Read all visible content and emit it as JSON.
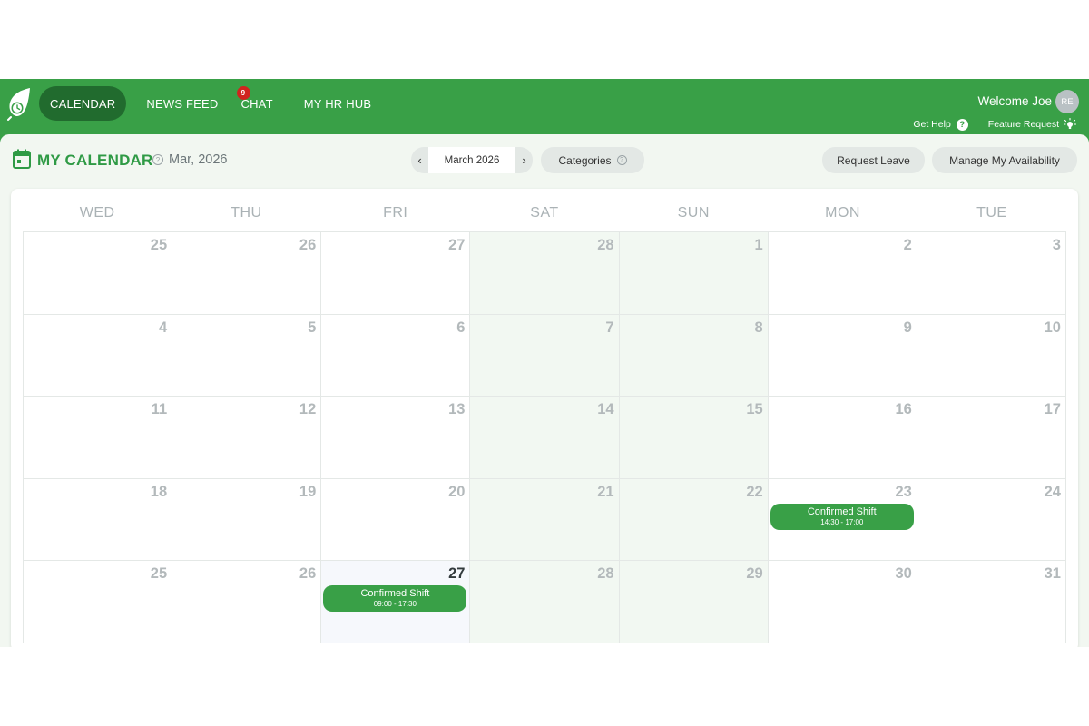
{
  "nav": {
    "items": [
      {
        "label": "CALENDAR",
        "active": true
      },
      {
        "label": "NEWS FEED",
        "active": false
      },
      {
        "label": "CHAT",
        "active": false,
        "badge": "9"
      },
      {
        "label": "MY HR HUB",
        "active": false
      }
    ]
  },
  "user": {
    "welcome": "Welcome Joe",
    "initials": "RE"
  },
  "utilities": {
    "help": "Get Help",
    "feature": "Feature Request"
  },
  "header": {
    "title": "MY CALENDAR",
    "period": "Mar, 2026",
    "month_label": "March 2026",
    "prev_arrow": "‹",
    "next_arrow": "›",
    "categories": "Categories",
    "request_leave": "Request Leave",
    "manage_availability": "Manage My Availability"
  },
  "calendar": {
    "weekdays": [
      "WED",
      "THU",
      "FRI",
      "SAT",
      "SUN",
      "MON",
      "TUE"
    ],
    "weekend_columns": [
      3,
      4
    ],
    "days": [
      "25",
      "26",
      "27",
      "28",
      "1",
      "2",
      "3",
      "4",
      "5",
      "6",
      "7",
      "8",
      "9",
      "10",
      "11",
      "12",
      "13",
      "14",
      "15",
      "16",
      "17",
      "18",
      "19",
      "20",
      "21",
      "22",
      "23",
      "24",
      "25",
      "26",
      "27",
      "28",
      "29",
      "30",
      "31"
    ],
    "today_index": 30,
    "events": [
      {
        "day_index": 26,
        "title": "Confirmed Shift",
        "time": "14:30 - 17:00"
      },
      {
        "day_index": 30,
        "title": "Confirmed Shift",
        "time": "09:00 - 17:30"
      }
    ]
  },
  "colors": {
    "brand": "#39a047",
    "nav_active": "#216b2e",
    "badge": "#d0241e",
    "weekend_bg": "#f2f8f2"
  }
}
